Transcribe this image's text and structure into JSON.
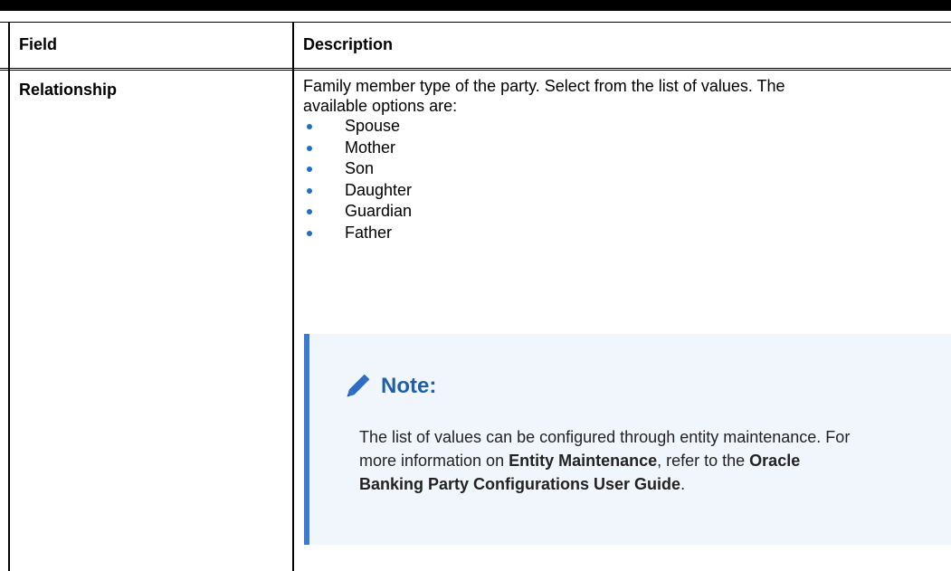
{
  "table": {
    "headers": {
      "field": "Field",
      "description": "Description"
    },
    "row": {
      "field": "Relationship",
      "description_line1": "Family member type of the party. Select from the list of values. The",
      "description_line2": "available options are:",
      "options": [
        "Spouse",
        "Mother",
        "Son",
        "Daughter",
        "Guardian",
        "Father"
      ]
    }
  },
  "note": {
    "icon": "pencil-icon",
    "title": "Note:",
    "text_1": "The list of values can be configured through entity maintenance. For more information on ",
    "bold_1": "Entity Maintenance",
    "text_2": ", refer to the ",
    "bold_2": "Oracle Banking Party Configurations User Guide",
    "text_3": "."
  },
  "colors": {
    "note_background": "#f1f6fc",
    "note_border": "#3b7bd4",
    "note_title": "#1e5fa8",
    "bullet": "#1f6fc5"
  }
}
